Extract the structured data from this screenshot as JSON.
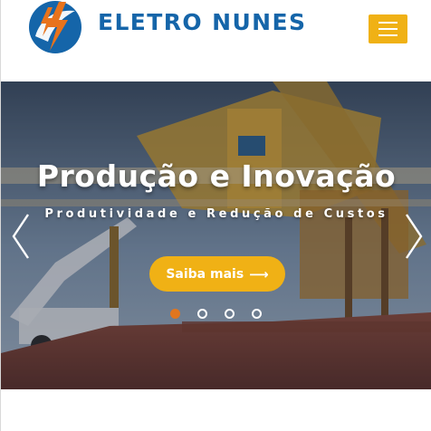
{
  "header": {
    "brand": "ELETRO NUNES",
    "logo_icon": "lightning-bolt-logo-icon",
    "menu_icon": "hamburger-icon"
  },
  "hero": {
    "title": "Produção e Inovação",
    "subtitle": "Produtividade e Redução de Custos",
    "cta_label": "Saiba mais",
    "cta_icon": "arrow-right-icon",
    "prev_icon": "chevron-left-icon",
    "next_icon": "chevron-right-icon",
    "slides_total": 4,
    "active_slide": 1
  },
  "colors": {
    "brand_blue": "#1565a9",
    "accent_yellow": "#f0b115",
    "active_dot": "#e0761f",
    "logo_orange": "#e8731c"
  }
}
